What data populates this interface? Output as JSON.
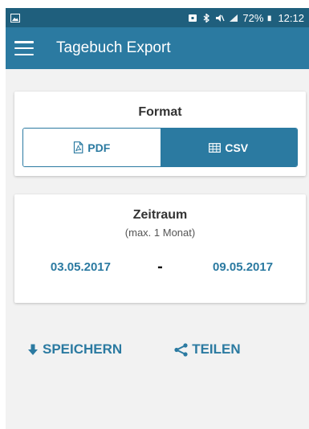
{
  "status_bar": {
    "battery": "72%",
    "time": "12:12",
    "icons": [
      "image-icon",
      "lock-icon",
      "bluetooth-icon",
      "mute-icon",
      "signal-icon",
      "battery-icon"
    ]
  },
  "app_bar": {
    "title": "Tagebuch Export",
    "menu_icon": "hamburger-menu-icon"
  },
  "format_card": {
    "title": "Format",
    "options": [
      {
        "label": "PDF",
        "icon": "pdf-file-icon",
        "selected": false
      },
      {
        "label": "CSV",
        "icon": "table-icon",
        "selected": true
      }
    ]
  },
  "range_card": {
    "title": "Zeitraum",
    "subtitle": "(max. 1 Monat)",
    "from": "03.05.2017",
    "separator": "-",
    "to": "09.05.2017"
  },
  "actions": {
    "save_label": "SPEICHERN",
    "save_icon": "download-arrow-icon",
    "share_label": "TEILEN",
    "share_icon": "share-icon"
  },
  "colors": {
    "status_bar": "#1f5f7d",
    "app_bar": "#2b7aa1",
    "accent": "#2b7aa1",
    "background": "#f2f2f2"
  }
}
